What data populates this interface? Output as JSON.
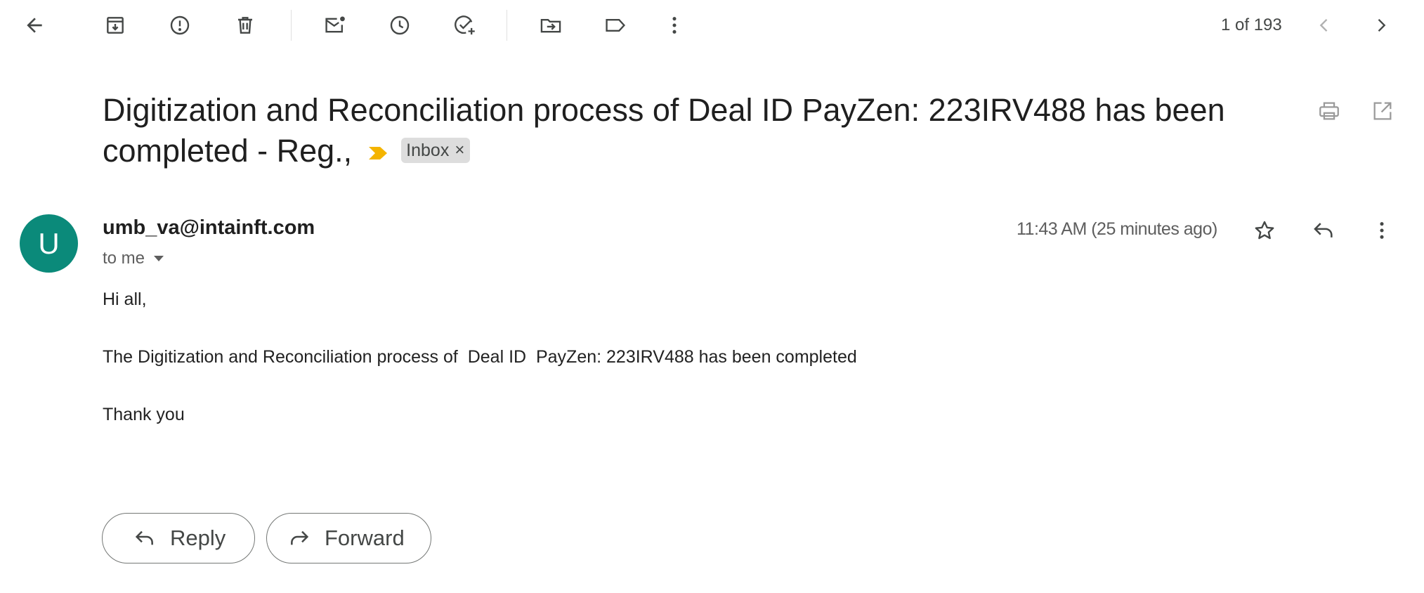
{
  "toolbar": {
    "icons": [
      "back-arrow-icon",
      "archive-icon",
      "report-spam-icon",
      "delete-icon",
      "mark-unread-icon",
      "snooze-icon",
      "add-task-icon",
      "move-to-icon",
      "label-icon",
      "more-vert-icon"
    ],
    "counter": "1 of 193"
  },
  "email": {
    "subject": "Digitization and Reconciliation process of Deal ID PayZen: 223IRV488 has been completed - Reg.,",
    "label_chip": "Inbox",
    "chip_close": "×",
    "sender": "umb_va@intainft.com",
    "avatar_letter": "U",
    "recipient": "to me",
    "time": "11:43 AM (25 minutes ago)",
    "body": {
      "greeting": "Hi all,",
      "message": "The Digitization and Reconciliation process of  Deal ID  PayZen: 223IRV488 has been completed",
      "closing": "Thank you"
    }
  },
  "actions": {
    "reply_label": "Reply",
    "forward_label": "Forward"
  },
  "colors": {
    "avatar": "#0b8a7a",
    "importance_marker": "#f4b400",
    "chip_background": "#dddddd"
  }
}
